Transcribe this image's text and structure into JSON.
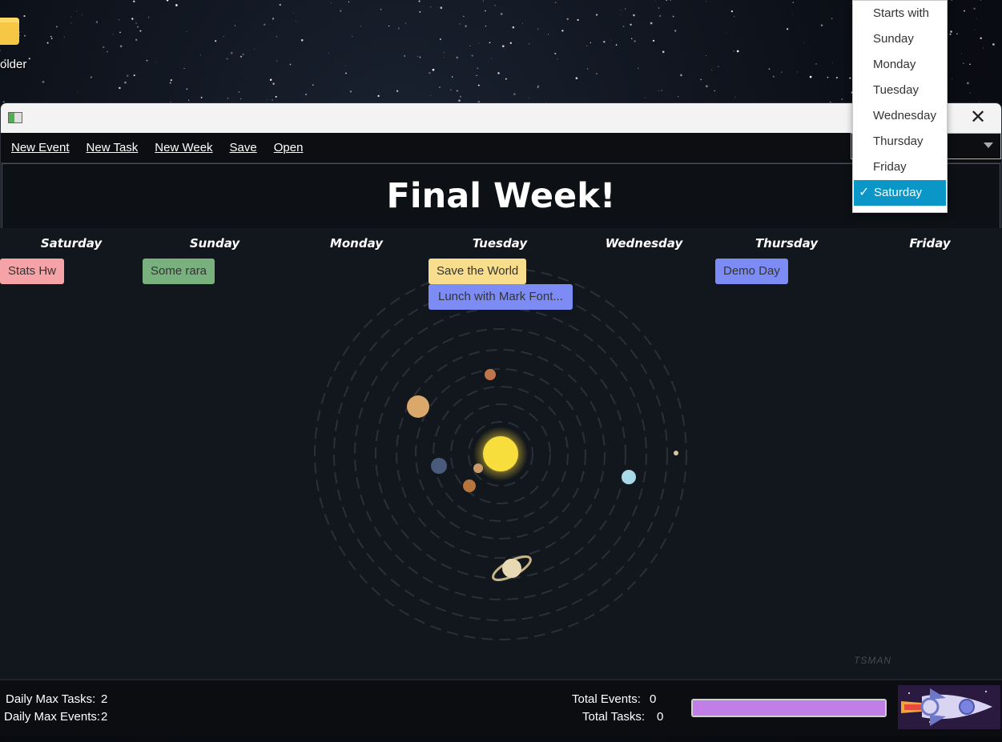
{
  "desktop": {
    "folder_label": "older"
  },
  "menu": {
    "items": [
      "New Event",
      "New Task",
      "New Week",
      "Save",
      "Open"
    ]
  },
  "week": {
    "title": "Final Week!"
  },
  "days": [
    {
      "name": "Saturday"
    },
    {
      "name": "Sunday"
    },
    {
      "name": "Monday"
    },
    {
      "name": "Tuesday"
    },
    {
      "name": "Wednesday"
    },
    {
      "name": "Thursday"
    },
    {
      "name": "Friday"
    }
  ],
  "entries": [
    {
      "label": "Stats Hw",
      "day": "Saturday",
      "color": "#f6a3a7"
    },
    {
      "label": "Some rara",
      "day": "Sunday",
      "color": "#78b07e"
    },
    {
      "label": "Save the World",
      "day": "Tuesday",
      "color": "#f8de8c"
    },
    {
      "label": "Lunch with Mark Font...",
      "day": "Tuesday",
      "color": "#7d8cf5"
    },
    {
      "label": "Demo Day",
      "day": "Thursday",
      "color": "#7d8cf5"
    }
  ],
  "watermark": "TSMAN",
  "footer": {
    "daily_max_tasks_label": "Daily Max Tasks:",
    "daily_max_tasks_value": "2",
    "daily_max_events_label": "Daily Max Events:",
    "daily_max_events_value": "2",
    "total_events_label": "Total Events:",
    "total_events_value": "0",
    "total_tasks_label": "Total Tasks:",
    "total_tasks_value": "0",
    "progress_fraction": 1.0
  },
  "start_day_dropdown": {
    "header": "Starts with",
    "options": [
      "Sunday",
      "Monday",
      "Tuesday",
      "Wednesday",
      "Thursday",
      "Friday",
      "Saturday"
    ],
    "selected": "Saturday",
    "check_glyph": "✓"
  },
  "colors": {
    "accent_selected": "#0a96c6",
    "progress": "#c17ee6"
  }
}
